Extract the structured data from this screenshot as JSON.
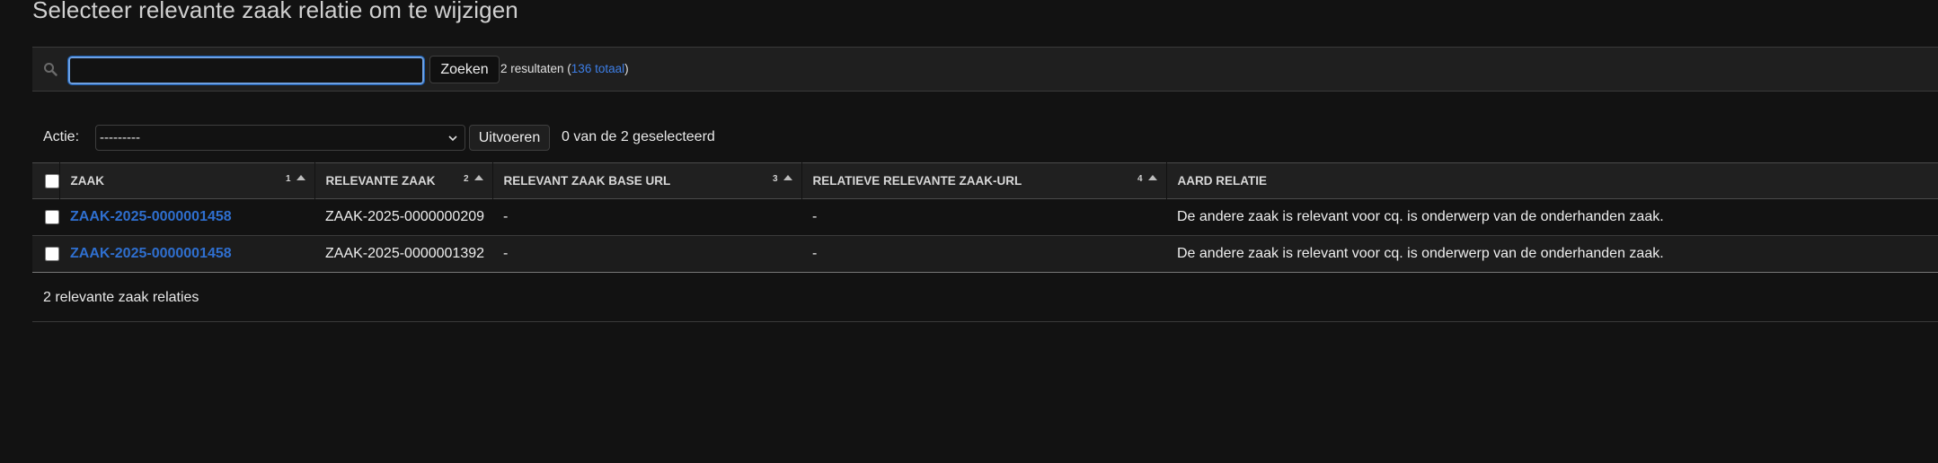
{
  "page": {
    "title": "Selecteer relevante zaak relatie om te wijzigen"
  },
  "search": {
    "value": "",
    "button_label": "Zoeken",
    "result_prefix": "2 resultaten (",
    "total_link": "136 totaal",
    "result_suffix": ")"
  },
  "actions": {
    "label": "Actie:",
    "selected_value": "---------",
    "run_label": "Uitvoeren",
    "selected_count": "0 van de 2 geselecteerd"
  },
  "table": {
    "columns": [
      {
        "label": "Zaak",
        "sort_order": "1"
      },
      {
        "label": "Relevante zaak",
        "sort_order": "2"
      },
      {
        "label": "Relevant zaak base url",
        "sort_order": "3"
      },
      {
        "label": "Relatieve relevante zaak-url",
        "sort_order": "4"
      },
      {
        "label": "Aard relatie",
        "sort_order": ""
      }
    ],
    "rows": [
      {
        "zaak": "ZAAK-2025-0000001458",
        "relevante_zaak": "ZAAK-2025-0000000209",
        "base_url": "-",
        "relatieve_url": "-",
        "aard_relatie": "De andere zaak is relevant voor cq. is onderwerp van de onderhanden zaak."
      },
      {
        "zaak": "ZAAK-2025-0000001458",
        "relevante_zaak": "ZAAK-2025-0000001392",
        "base_url": "-",
        "relatieve_url": "-",
        "aard_relatie": "De andere zaak is relevant voor cq. is onderwerp van de onderhanden zaak."
      }
    ]
  },
  "footer": {
    "count_text": "2 relevante zaak relaties"
  },
  "colors": {
    "background": "#121212",
    "link": "#2f6fcf",
    "focus_border": "#6fa0e0"
  }
}
